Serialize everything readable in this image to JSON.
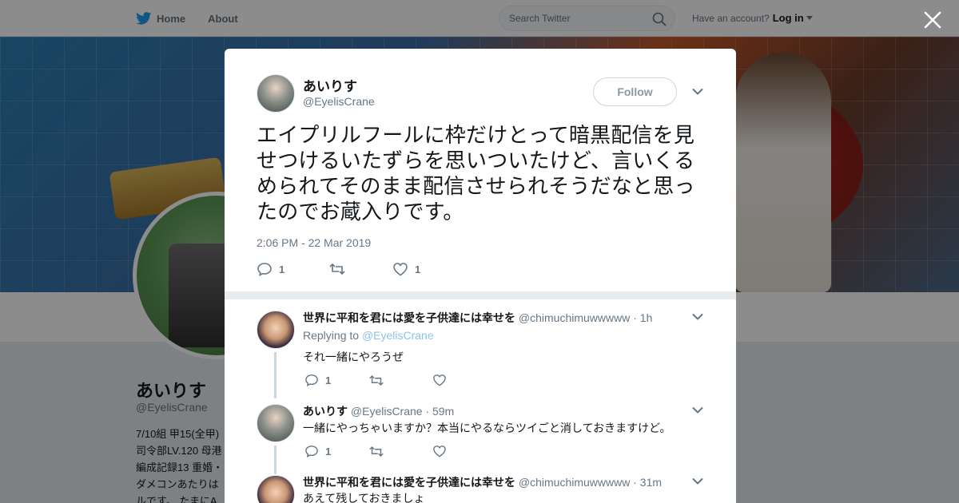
{
  "nav": {
    "home_label": "Home",
    "about_label": "About",
    "search_placeholder": "Search Twitter",
    "account_prompt": "Have an account?",
    "login_label": "Log in"
  },
  "profile": {
    "name": "あいりす",
    "handle": "@EyelisCrane",
    "bio_lines": [
      "7/10組 甲15(全甲)",
      "司令部LV.120 母港",
      "編成記録13 重婚・",
      "ダメコンあたりは",
      "ルです。 たまにA"
    ]
  },
  "tweet": {
    "author_name": "あいりす",
    "author_handle": "@EyelisCrane",
    "follow_label": "Follow",
    "text": "エイプリルフールに枠だけとって暗黒配信を見せつけるいたずらを思いついたけど、言いくるめられてそのまま配信させられそうだなと思ったのでお蔵入りです。",
    "timestamp": "2:06 PM - 22 Mar 2019",
    "reply_count": "1",
    "like_count": "1"
  },
  "replies": [
    {
      "name": "世界に平和を君には愛を子供達には幸せを",
      "handle": "@chimuchimuwwwww",
      "time": "· 1h",
      "replying_prefix": "Replying to",
      "replying_handle": "@EyelisCrane",
      "text": "それ一緒にやろうぜ",
      "reply_count": "1"
    },
    {
      "name": "あいりす",
      "handle": "@EyelisCrane",
      "time": "· 59m",
      "text": "一緒にやっちゃいますか？本当にやるならツイごと消しておきますけど。",
      "reply_count": "1"
    },
    {
      "name": "世界に平和を君には愛を子供達には幸せを",
      "handle": "@chimuchimuwwwww",
      "time": "· 31m",
      "text": "あえて残しておきましょ"
    }
  ],
  "colors": {
    "brand": "#1da1f2",
    "text_primary": "#14171a",
    "text_secondary": "#657786"
  },
  "icons": [
    "twitter-bird-icon",
    "search-icon",
    "close-icon",
    "chevron-down-icon",
    "reply-icon",
    "retweet-icon",
    "like-icon"
  ]
}
